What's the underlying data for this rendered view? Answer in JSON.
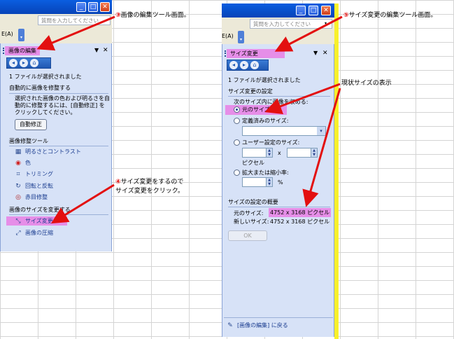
{
  "left_panel": {
    "ask_placeholder": "質問を入力してください",
    "menu_fragment": "E(A)",
    "pane_title": "画像の編集",
    "status": "1 ファイルが選択されました",
    "autofix_heading": "自動的に画像を修整する",
    "autofix_desc_1": "選択された画像の色および明るさを自",
    "autofix_desc_2": "動的に修整するには、[自動修正] を",
    "autofix_desc_3": "クリックしてください。",
    "autofix_button": "自動修正",
    "tools_heading": "画像修整ツール",
    "tools": [
      {
        "label": "明るさとコントラスト",
        "icon": "brightness-icon"
      },
      {
        "label": "色",
        "icon": "color-icon"
      },
      {
        "label": "トリミング",
        "icon": "crop-icon"
      },
      {
        "label": "回転と反転",
        "icon": "rotate-icon"
      },
      {
        "label": "赤目修整",
        "icon": "redeye-icon"
      }
    ],
    "resize_heading": "画像のサイズを変更する",
    "resize_links": [
      {
        "label": "サイズ変更",
        "icon": "resize-icon"
      },
      {
        "label": "画像の圧縮",
        "icon": "compress-icon"
      }
    ]
  },
  "right_panel": {
    "ask_placeholder": "質問を入力してください",
    "menu_fragment": "E(A)",
    "pane_title": "サイズ変更",
    "status": "1 ファイルが選択されました",
    "settings_heading": "サイズ変更の設定",
    "resize_instruction": "次のサイズ内に画像を収める:",
    "option_original": "元のサイズ",
    "option_predefined": "定義済みのサイズ:",
    "option_custom": "ユーザー設定のサイズ:",
    "times": "x",
    "pixels": "ピクセル",
    "option_percent": "拡大または縮小率:",
    "percent_sign": "%",
    "summary_heading": "サイズの設定の概要",
    "original_label": "元のサイズ:",
    "original_value": "4752 x 3168 ピクセル",
    "new_label": "新しいサイズ:",
    "new_value": "4752 x 3168 ピクセル",
    "ok_button": "OK",
    "back_link": "[画像の編集] に戻る"
  },
  "annotations": {
    "a3_num": "③",
    "a3_text": "画像の編集ツール画面。",
    "a4_num": "④",
    "a4_line1": "サイズ変更をするので",
    "a4_line2": "サイズ変更をクリック。",
    "a5_num": "⑤",
    "a5_text": "サイズ変更の編集ツール画面。",
    "current_size_label": "現状サイズの表示"
  },
  "colors": {
    "highlight": "#e68ee8",
    "arrow": "#e31010",
    "titlebar": "#0743b8",
    "pane": "#d7e2f7"
  }
}
